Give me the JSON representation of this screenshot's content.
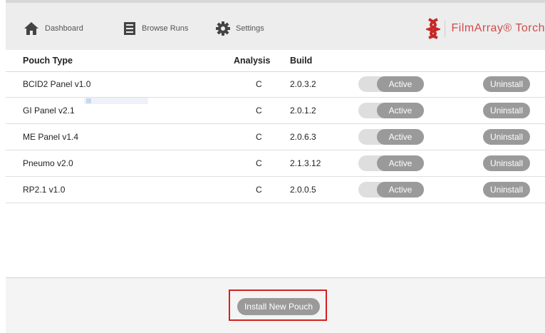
{
  "nav": {
    "dashboard_label": "Dashboard",
    "browse_runs_label": "Browse Runs",
    "settings_label": "Settings",
    "icons": {
      "dashboard": "home-icon",
      "browse_runs": "list-icon",
      "settings": "gear-icon"
    }
  },
  "brand": {
    "name": "FilmArray® Torch",
    "logo": "dna-helix-logo",
    "color": "#d24a4a"
  },
  "table": {
    "headers": {
      "pouch_type": "Pouch Type",
      "analysis": "Analysis",
      "build": "Build"
    },
    "rows": [
      {
        "pouch_type": "BCID2 Panel v1.0",
        "analysis": "C",
        "build": "2.0.3.2",
        "status": "Active",
        "action": "Uninstall"
      },
      {
        "pouch_type": "GI Panel v2.1",
        "analysis": "C",
        "build": "2.0.1.2",
        "status": "Active",
        "action": "Uninstall"
      },
      {
        "pouch_type": "ME Panel v1.4",
        "analysis": "C",
        "build": "2.0.6.3",
        "status": "Active",
        "action": "Uninstall"
      },
      {
        "pouch_type": "Pneumo v2.0",
        "analysis": "C",
        "build": "2.1.3.12",
        "status": "Active",
        "action": "Uninstall"
      },
      {
        "pouch_type": "RP2.1 v1.0",
        "analysis": "C",
        "build": "2.0.0.5",
        "status": "Active",
        "action": "Uninstall"
      }
    ]
  },
  "footer": {
    "install_label": "Install New Pouch"
  },
  "colors": {
    "button_gray": "#9a9a9a",
    "highlight_red": "#d32020",
    "toolbar_bg": "#ededed"
  }
}
